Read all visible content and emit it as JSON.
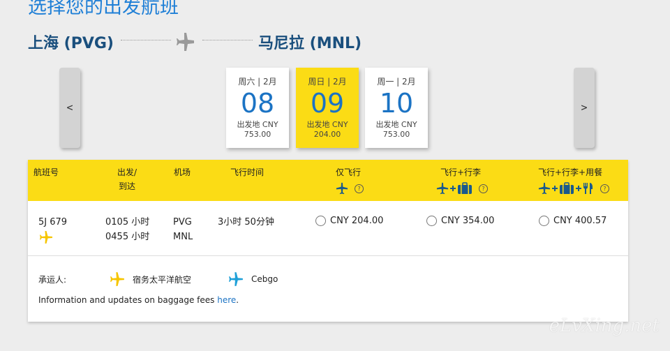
{
  "page": {
    "title": "选择您的出发航班"
  },
  "route": {
    "origin": "上海 (PVG)",
    "destination": "马尼拉 (MNL)"
  },
  "date_nav": {
    "prev_label": "<",
    "next_label": ">"
  },
  "dates": [
    {
      "weekday_month": "周六 | 2月",
      "day": "08",
      "from_label": "出发地 CNY",
      "price": "753.00",
      "selected": false
    },
    {
      "weekday_month": "周日 | 2月",
      "day": "09",
      "from_label": "出发地 CNY",
      "price": "204.00",
      "selected": true
    },
    {
      "weekday_month": "周一 | 2月",
      "day": "10",
      "from_label": "出发地 CNY",
      "price": "753.00",
      "selected": false
    }
  ],
  "table": {
    "headers": {
      "flight_no": "航班号",
      "depart_arrive_1": "出发/",
      "depart_arrive_2": "到达",
      "airport": "机场",
      "duration": "飞行时间",
      "fare1": "仅飞行",
      "fare2": "飞行+行李",
      "fare3": "飞行+行李+用餐"
    },
    "help_glyph": "?",
    "rows": [
      {
        "flight_no": "5J 679",
        "depart_time": "0105 小时",
        "arrive_time": "0455 小时",
        "depart_airport": "PVG",
        "arrive_airport": "MNL",
        "duration": "3小时 50分钟",
        "fare1": "CNY 204.00",
        "fare2": "CNY 354.00",
        "fare3": "CNY 400.57"
      }
    ]
  },
  "carriers": {
    "label": "承运人:",
    "items": [
      {
        "name": "宿务太平洋航空",
        "color": "#f6c500"
      },
      {
        "name": "Cebgo",
        "color": "#1fa0d8"
      }
    ]
  },
  "baggage_info": {
    "text": "Information and updates on baggage fees ",
    "link": "here",
    "suffix": "."
  },
  "watermark": "eLvXing.net",
  "colors": {
    "accent_yellow": "#fbdc15",
    "brand_blue": "#1b73c4",
    "route_blue": "#1a4f7d",
    "title_blue": "#1f7fd6"
  }
}
